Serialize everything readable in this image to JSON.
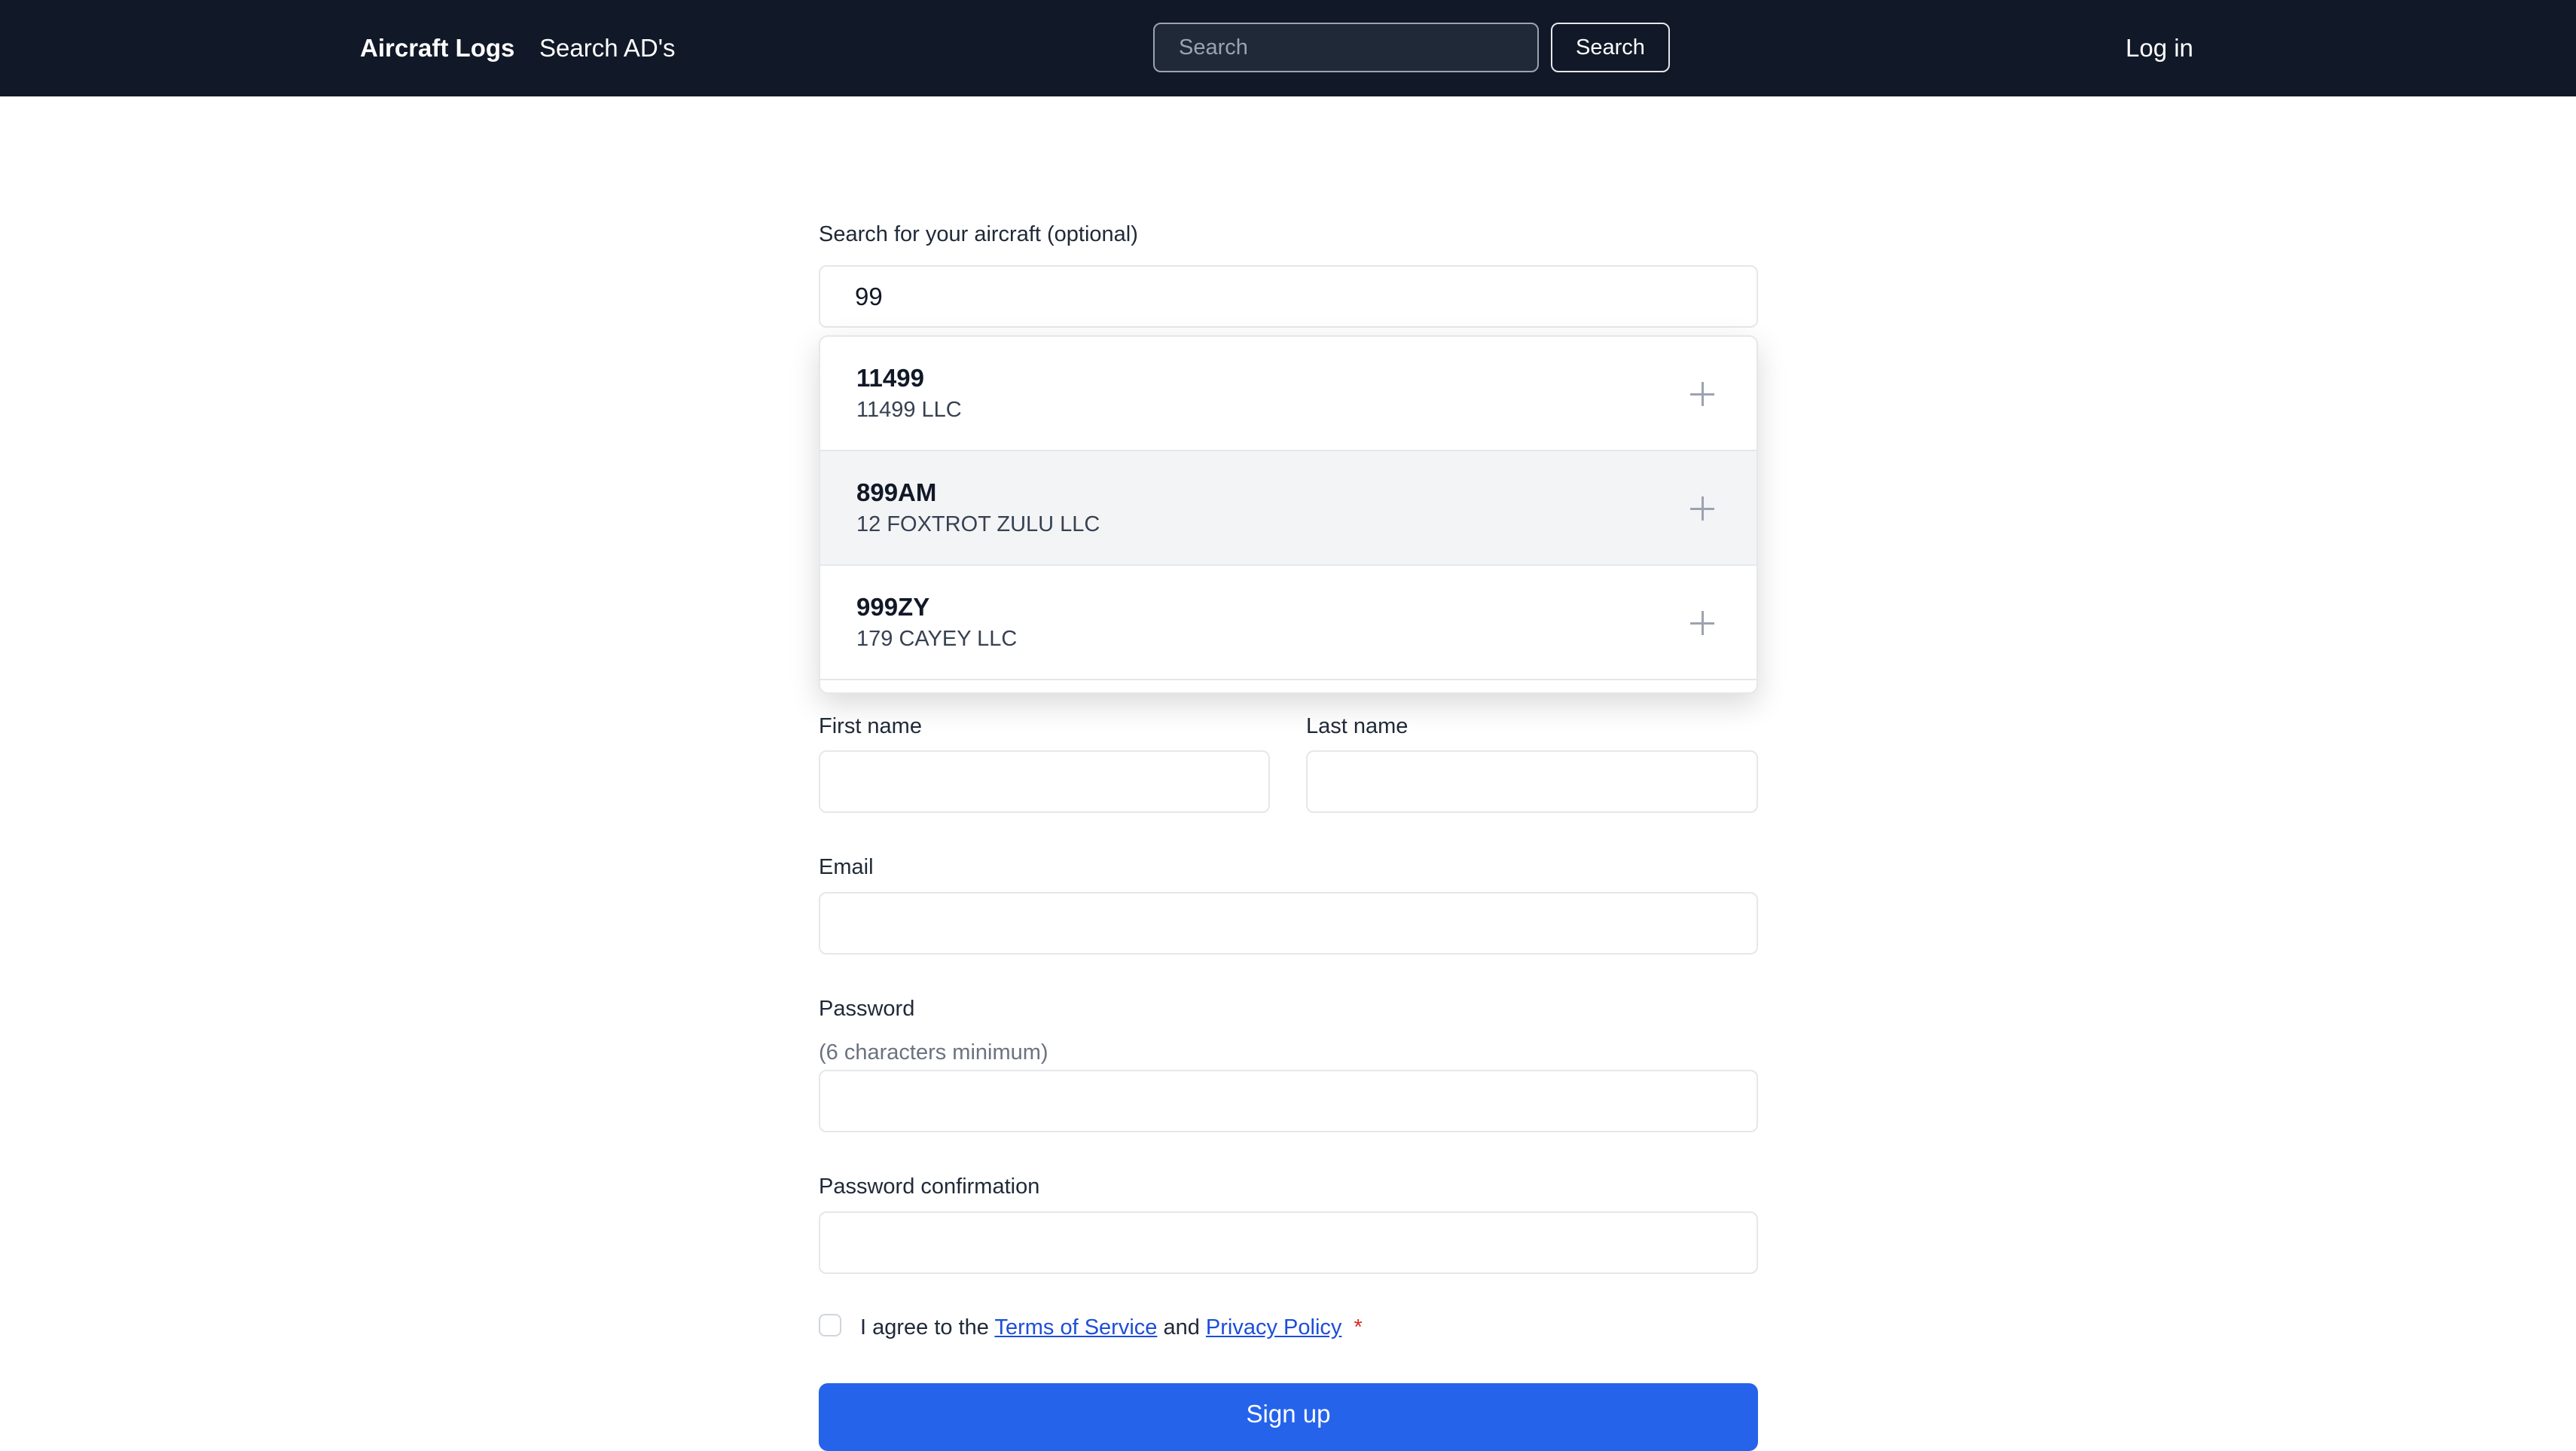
{
  "nav": {
    "brand": "Aircraft Logs",
    "search_ads": "Search AD's",
    "search_placeholder": "Search",
    "search_button": "Search",
    "login": "Log in"
  },
  "form": {
    "aircraft_search_label": "Search for your aircraft (optional)",
    "aircraft_search_value": "99",
    "dropdown_options": [
      {
        "tail": "11499",
        "owner": "11499 LLC"
      },
      {
        "tail": "899AM",
        "owner": "12 FOXTROT ZULU LLC",
        "highlighted": true
      },
      {
        "tail": "999ZY",
        "owner": "179 CAYEY LLC"
      }
    ],
    "first_name_label": "First name",
    "last_name_label": "Last name",
    "email_label": "Email",
    "password_label": "Password",
    "password_hint": "(6 characters minimum)",
    "password_confirmation_label": "Password confirmation",
    "agree_prefix": "I agree to the",
    "terms_link": "Terms of Service",
    "agree_and": "and",
    "privacy_link": "Privacy Policy",
    "required_mark": "*",
    "signup_button": "Sign up"
  },
  "colors": {
    "nav_background": "#111827",
    "primary_button": "#2563eb",
    "link": "#1d4ed8",
    "required": "#dc2626"
  }
}
